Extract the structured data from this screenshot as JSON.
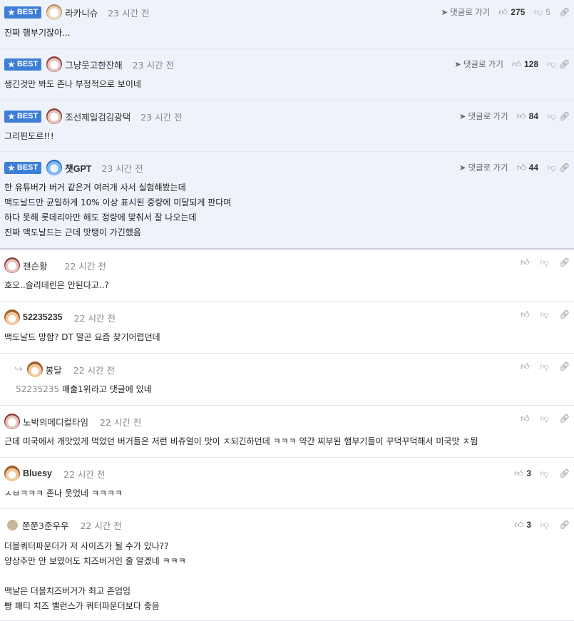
{
  "best_badge": "BEST",
  "reply_link_label": "댓글로 가기",
  "comments": [
    {
      "nick": "라카니슈",
      "time": "23 시간 전",
      "likes": "275",
      "dislikes": "5",
      "lines": "진짜 햄부기잖아..."
    },
    {
      "nick": "그냥웃고한잔해",
      "time": "23 시간 전",
      "likes": "128",
      "lines": "생긴것만 봐도 존나 부정적으로 보이네"
    },
    {
      "nick": "조선제일검김광택",
      "time": "23 시간 전",
      "likes": "84",
      "lines": "그리핀도르!!!"
    },
    {
      "nick": "챗GPT",
      "time": "23 시간 전",
      "likes": "44",
      "lines": "한 유튜버가 버거 같은거 여러개 사서 실험해봤는데\n맥도날드만 균일하게 10% 이상 표시된 중량에 미달되게 판다며\n하다 못해 롯데리아만 해도 정량에 맞춰서 잘 나오는데\n진짜 맥도날드는 근데 맛탱이 가긴했음"
    },
    {
      "nick": "잰슨황",
      "time": "22 시간 전",
      "lines": "호오..슬리데린은 안된다고..?"
    },
    {
      "nick": "52235235",
      "time": "22 시간 전",
      "lines": "맥도날드 망함? DT 말곤 요즘 찾기어렵던데"
    },
    {
      "nick": "봉달",
      "time": "22 시간 전",
      "mention": "52235235",
      "lines": "매출1위라고 댓글에 있네"
    },
    {
      "nick": "노박의메디컬타임",
      "time": "22 시간 전",
      "lines": "근데 미국에서 개맛있게 먹었던 버거들은 저런 비쥬얼이 맛이 ㅈ되긴하던데 ㅋㅋㅋ 약간 찌부된 햄부기들이 꾸덕꾸덕해서 미국맛 ㅈ됨"
    },
    {
      "nick": "Bluesy",
      "time": "22 시간 전",
      "likes": "3",
      "lines": "ㅅㅂㅋㅋㅋ 존나 웃었네 ㅋㅋㅋㅋ"
    },
    {
      "nick": "쭌쭌3준우우",
      "time": "22 시간 전",
      "likes": "3",
      "lines": "더블쿼터파운더가 저 사이즈가 될 수가 있나??\n양상추만 안 보였어도 치즈버거인 줄 알겠네 ㅋㅋㅋ\n\n맥날은 더블치즈버거가 최고 존엄임\n빵 패티 치즈 밸런스가 쿼터파운더보다 좋음"
    }
  ]
}
